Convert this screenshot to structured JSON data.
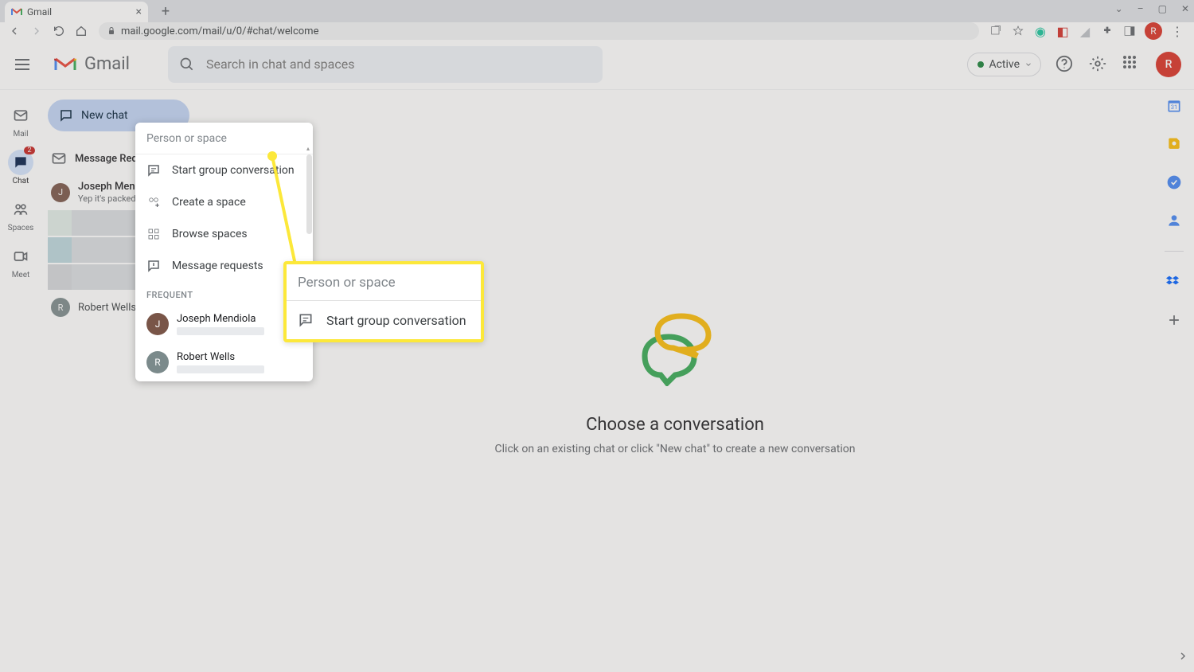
{
  "browser": {
    "tab_title": "Gmail",
    "url": "mail.google.com/mail/u/0/#chat/welcome"
  },
  "header": {
    "product_name": "Gmail",
    "search_placeholder": "Search in chat and spaces",
    "status": "Active",
    "avatar_initial": "R"
  },
  "left_rail": {
    "items": [
      {
        "label": "Mail"
      },
      {
        "label": "Chat",
        "badge": "2"
      },
      {
        "label": "Spaces"
      },
      {
        "label": "Meet"
      }
    ]
  },
  "chat_panel": {
    "new_chat_label": "New chat",
    "message_requests_label": "Message Requests",
    "conversations": [
      {
        "name": "Joseph Mendiola",
        "snippet": "Yep it's packed!"
      }
    ],
    "bottom_contact": "Robert Wells"
  },
  "popover": {
    "placeholder": "Person or space",
    "items": [
      "Start group conversation",
      "Create a space",
      "Browse spaces",
      "Message requests"
    ],
    "section_label": "FREQUENT",
    "frequent": [
      {
        "name": "Joseph Mendiola",
        "initial": "J"
      },
      {
        "name": "Robert Wells",
        "initial": "R"
      }
    ]
  },
  "callout": {
    "placeholder": "Person or space",
    "item": "Start group conversation"
  },
  "empty_state": {
    "title": "Choose a conversation",
    "subtitle": "Click on an existing chat or click \"New chat\" to create a new conversation"
  }
}
